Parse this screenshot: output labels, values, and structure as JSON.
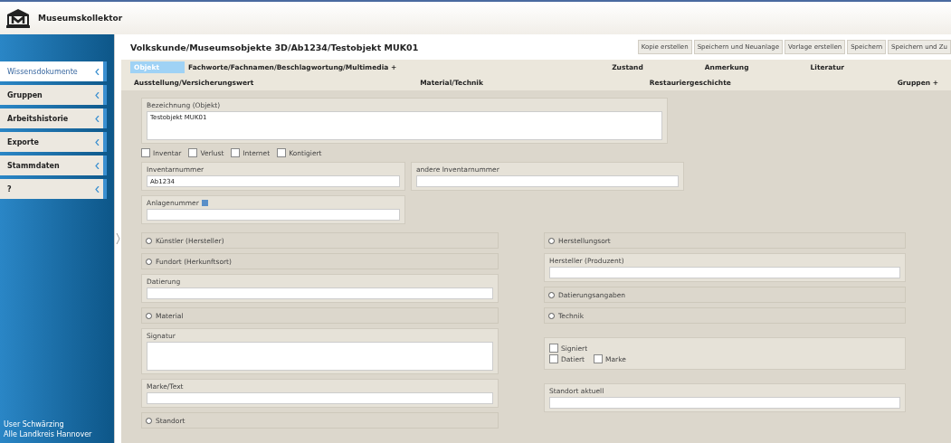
{
  "app": {
    "title": "Museumskollektor"
  },
  "sidebar": {
    "items": [
      {
        "label": "Wissensdokumente",
        "selected": true
      },
      {
        "label": "Gruppen",
        "selected": false
      },
      {
        "label": "Arbeitshistorie",
        "selected": false
      },
      {
        "label": "Exporte",
        "selected": false
      },
      {
        "label": "Stammdaten",
        "selected": false
      },
      {
        "label": "?",
        "selected": false
      }
    ],
    "footer": [
      "User Schwärzing",
      "Alle Landkreis Hannover"
    ]
  },
  "breadcrumb": "Volkskunde/Museumsobjekte 3D/Ab1234/Testobjekt MUK01",
  "toolbar": [
    "Kopie erstellen",
    "Speichern und Neuanlage",
    "Vorlage erstellen",
    "Speichern",
    "Speichern und Zu"
  ],
  "tabs": [
    [
      {
        "label": "Objekt",
        "selected": true
      },
      {
        "label": "Fachworte/Fachnamen/Beschlagwortung/Multimedia +",
        "selected": false
      },
      {
        "label": "Zustand",
        "selected": false
      },
      {
        "label": "Anmerkung",
        "selected": false
      },
      {
        "label": "Literatur",
        "selected": false
      }
    ],
    [
      {
        "label": "Ausstellung/Versicherungswert",
        "selected": false
      },
      {
        "label": "Material/Technik",
        "selected": false
      },
      {
        "label": "Restauriergeschichte",
        "selected": false
      },
      {
        "label": "Gruppen +",
        "selected": false
      }
    ]
  ],
  "form": {
    "title_field": {
      "label": "Bezeichnung (Objekt)",
      "value": "Testobjekt MUK01"
    },
    "flags": [
      {
        "label": "Inventar",
        "checked": false
      },
      {
        "label": "Verlust",
        "checked": false
      },
      {
        "label": "Internet",
        "checked": false
      },
      {
        "label": "Kontigiert",
        "checked": false
      }
    ],
    "inventory": {
      "label": "Inventarnummer",
      "value": "Ab1234"
    },
    "other_inventory": {
      "label": "andere Inventarnummer"
    },
    "attachment": {
      "label": "Anlagenummer"
    },
    "left": [
      {
        "kind": "section",
        "label": "Künstler (Hersteller)"
      },
      {
        "kind": "section",
        "label": "Fundort (Herkunftsort)"
      },
      {
        "kind": "text",
        "label": "Datierung"
      },
      {
        "kind": "section",
        "label": "Material"
      },
      {
        "kind": "textarea",
        "label": "Signatur"
      },
      {
        "kind": "text",
        "label": "Marke/Text"
      },
      {
        "kind": "section",
        "label": "Standort"
      }
    ],
    "right": [
      {
        "kind": "section",
        "label": "Herstellungsort"
      },
      {
        "kind": "text",
        "label": "Hersteller (Produzent)"
      },
      {
        "kind": "section",
        "label": "Datierungsangaben"
      },
      {
        "kind": "section",
        "label": "Technik"
      },
      {
        "kind": "checks",
        "items": [
          {
            "label": "Signiert",
            "checked": false
          },
          {
            "label": "Datiert",
            "checked": false
          },
          {
            "label": "Marke",
            "checked": false
          }
        ]
      },
      {
        "kind": "text",
        "label": "Standort aktuell"
      }
    ]
  }
}
